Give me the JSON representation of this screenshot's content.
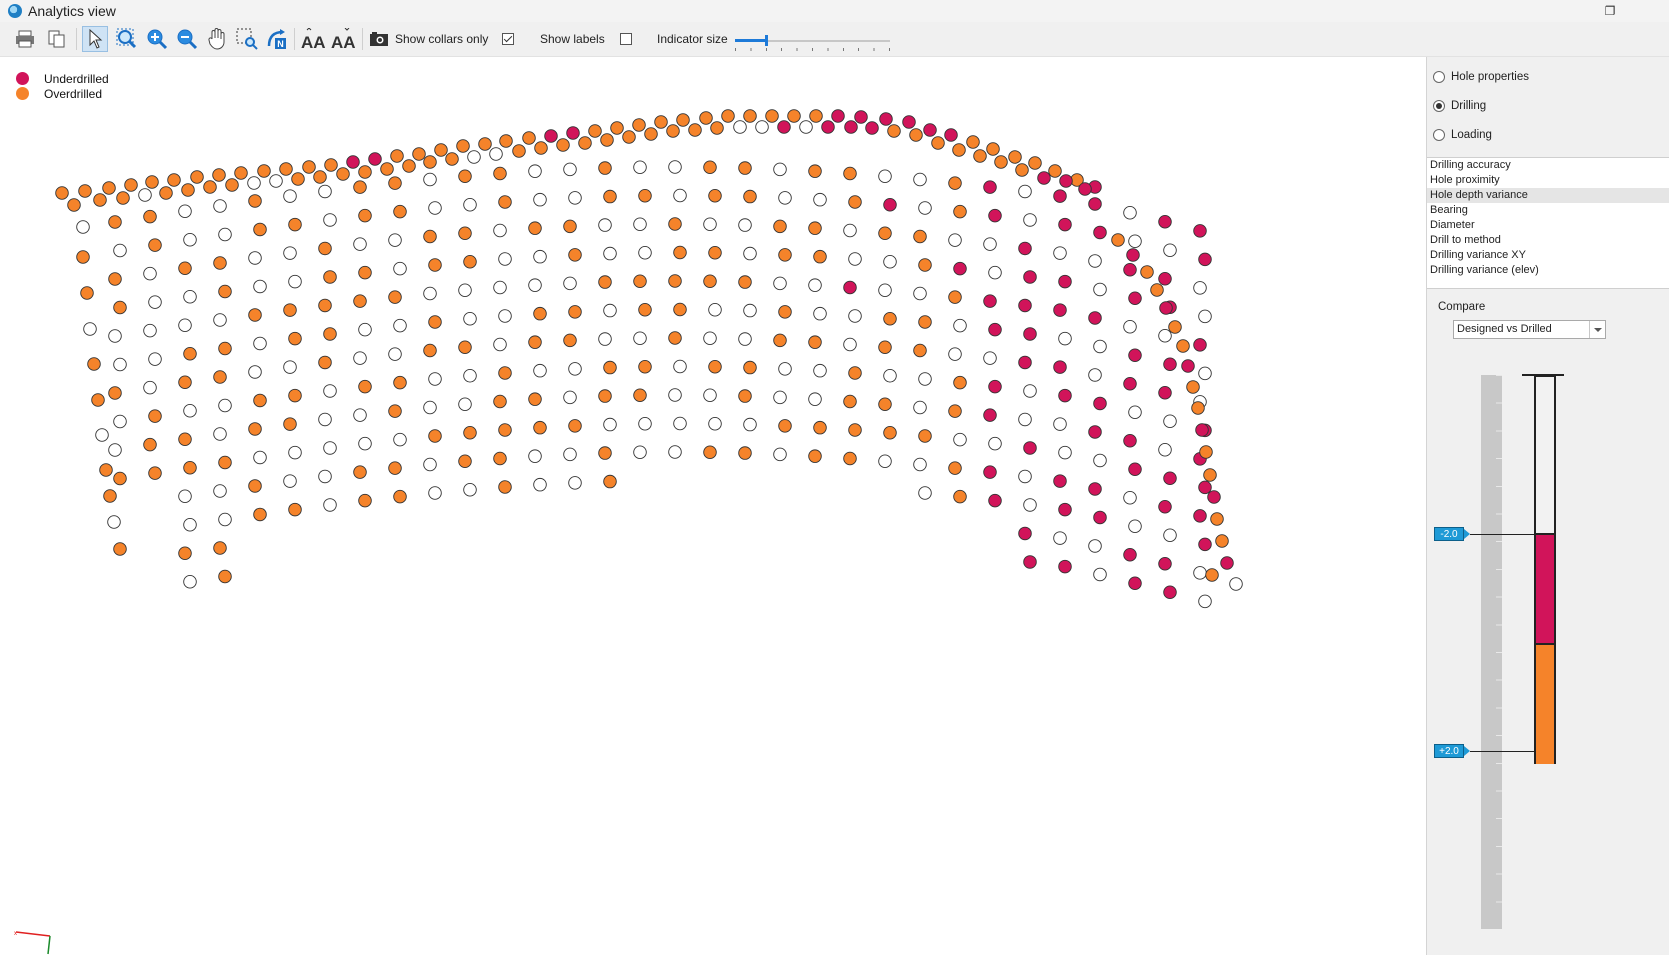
{
  "window": {
    "title": "Analytics view"
  },
  "toolbar": {
    "show_collars_label": "Show collars only",
    "show_collars_checked": true,
    "show_labels_label": "Show labels",
    "show_labels_checked": false,
    "indicator_size_label": "Indicator size",
    "indicator_size_value": 0.2,
    "icons": [
      "print-icon",
      "copy-icon",
      "select-arrow-icon",
      "zoom-extents-icon",
      "zoom-in-icon",
      "zoom-out-icon",
      "pan-hand-icon",
      "zoom-window-icon",
      "north-view-icon",
      "increase-text-size-icon",
      "decrease-text-size-icon",
      "camera-icon"
    ]
  },
  "legend": {
    "items": [
      {
        "label": "Underdrilled",
        "color": "#d1145a"
      },
      {
        "label": "Overdrilled",
        "color": "#f5832a"
      }
    ]
  },
  "colors": {
    "underdrilled": "#d1145a",
    "overdrilled": "#f5832a",
    "neutral": "#ffffff",
    "tag": "#1e9ad6"
  },
  "side_panel": {
    "radios": [
      {
        "label": "Hole properties",
        "checked": false
      },
      {
        "label": "Drilling",
        "checked": true
      },
      {
        "label": "Loading",
        "checked": false
      }
    ],
    "analyses": [
      "Drilling accuracy",
      "Hole proximity",
      "Hole depth variance",
      "Bearing",
      "Diameter",
      "Drill to method",
      "Drilling variance XY",
      "Drilling variance (elev)"
    ],
    "selected_analysis": "Hole depth variance",
    "compare_label": "Compare",
    "compare_value": "Designed vs Drilled",
    "scale": {
      "under_tag": "-2.0",
      "over_tag": "+2.0"
    }
  },
  "holes": {
    "note_for_render": "",
    "rows": [
      {
        "n": "u",
        "p": [
          [
            62,
            193
          ],
          [
            85,
            191
          ],
          [
            109,
            188
          ],
          [
            131,
            185
          ],
          [
            152,
            182
          ],
          [
            174,
            180
          ],
          [
            197,
            177
          ],
          [
            219,
            175
          ],
          [
            241,
            173
          ],
          [
            264,
            171
          ],
          [
            286,
            169
          ],
          [
            309,
            167
          ],
          [
            331,
            165
          ],
          [
            353,
            162
          ],
          [
            375,
            159
          ],
          [
            397,
            156
          ],
          [
            419,
            154
          ],
          [
            441,
            150
          ],
          [
            463,
            146
          ],
          [
            485,
            144
          ],
          [
            506,
            141
          ],
          [
            529,
            138
          ],
          [
            551,
            136
          ],
          [
            573,
            133
          ],
          [
            595,
            131
          ],
          [
            617,
            128
          ],
          [
            639,
            125
          ],
          [
            661,
            122
          ],
          [
            683,
            120
          ],
          [
            706,
            118
          ],
          [
            728,
            116
          ],
          [
            750,
            116
          ],
          [
            772,
            116
          ],
          [
            794,
            116
          ],
          [
            816,
            116
          ],
          [
            838,
            116
          ],
          [
            861,
            117
          ],
          [
            886,
            119
          ],
          [
            909,
            122
          ],
          [
            930,
            130
          ],
          [
            951,
            135
          ],
          [
            973,
            142
          ],
          [
            993,
            149
          ],
          [
            1015,
            157
          ],
          [
            1035,
            163
          ],
          [
            1055,
            171
          ],
          [
            1077,
            180
          ],
          [
            1095,
            187
          ]
        ],
        "c": "ooooooooooooouuooooooouuooooooooooouuuuuuoooooouuu"
      },
      {
        "n": "r2",
        "p": [
          [
            74,
            205
          ],
          [
            100,
            200
          ],
          [
            123,
            198
          ],
          [
            145,
            195
          ],
          [
            166,
            193
          ],
          [
            188,
            190
          ],
          [
            210,
            187
          ],
          [
            232,
            185
          ],
          [
            254,
            183
          ],
          [
            276,
            181
          ],
          [
            298,
            179
          ],
          [
            320,
            177
          ],
          [
            343,
            174
          ],
          [
            365,
            172
          ],
          [
            387,
            169
          ],
          [
            409,
            166
          ],
          [
            430,
            162
          ],
          [
            452,
            159
          ],
          [
            474,
            157
          ],
          [
            496,
            154
          ],
          [
            519,
            151
          ],
          [
            541,
            148
          ],
          [
            563,
            145
          ],
          [
            585,
            143
          ],
          [
            607,
            140
          ],
          [
            629,
            137
          ],
          [
            651,
            134
          ],
          [
            673,
            131
          ],
          [
            695,
            130
          ],
          [
            717,
            128
          ],
          [
            740,
            127
          ],
          [
            762,
            127
          ],
          [
            784,
            127
          ],
          [
            806,
            127
          ],
          [
            828,
            127
          ],
          [
            851,
            127
          ],
          [
            872,
            128
          ],
          [
            894,
            131
          ],
          [
            916,
            135
          ],
          [
            938,
            143
          ],
          [
            959,
            150
          ],
          [
            980,
            156
          ],
          [
            1001,
            162
          ],
          [
            1022,
            170
          ],
          [
            1044,
            178
          ],
          [
            1066,
            181
          ],
          [
            1085,
            189
          ]
        ],
        "c": "ooowoooowwoooooooowwoooooooooowwuwuuuooooooouuuuu"
      }
    ]
  }
}
